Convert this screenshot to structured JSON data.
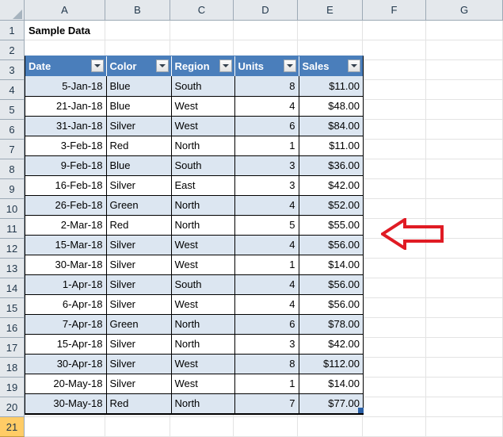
{
  "app": {
    "type": "spreadsheet",
    "title_cell": "Sample Data"
  },
  "colors": {
    "header_blue": "#4A7EBB",
    "band_blue": "#DCE6F1",
    "gutter_gray": "#E4E8EC",
    "active_row_gold": "#FFCC66",
    "annotation_red": "#E01B24",
    "gridline": "#E3E3E3"
  },
  "column_headers": [
    "A",
    "B",
    "C",
    "D",
    "E",
    "F",
    "G"
  ],
  "row_headers": [
    "1",
    "2",
    "3",
    "4",
    "5",
    "6",
    "7",
    "8",
    "9",
    "10",
    "11",
    "12",
    "13",
    "14",
    "15",
    "16",
    "17",
    "18",
    "19",
    "20",
    "21"
  ],
  "active_row_header": "21",
  "table": {
    "range": "A3:E20",
    "columns": [
      {
        "label": "Date",
        "align": "right",
        "filter": true
      },
      {
        "label": "Color",
        "align": "left",
        "filter": true
      },
      {
        "label": "Region",
        "align": "left",
        "filter": true
      },
      {
        "label": "Units",
        "align": "right",
        "filter": true
      },
      {
        "label": "Sales",
        "align": "right",
        "filter": true
      }
    ],
    "rows": [
      {
        "row": "4",
        "date": "5-Jan-18",
        "color": "Blue",
        "region": "South",
        "units": "8",
        "sales": "$11.00"
      },
      {
        "row": "5",
        "date": "21-Jan-18",
        "color": "Blue",
        "region": "West",
        "units": "4",
        "sales": "$48.00"
      },
      {
        "row": "6",
        "date": "31-Jan-18",
        "color": "Silver",
        "region": "West",
        "units": "6",
        "sales": "$84.00"
      },
      {
        "row": "7",
        "date": "3-Feb-18",
        "color": "Red",
        "region": "North",
        "units": "1",
        "sales": "$11.00"
      },
      {
        "row": "8",
        "date": "9-Feb-18",
        "color": "Blue",
        "region": "South",
        "units": "3",
        "sales": "$36.00"
      },
      {
        "row": "9",
        "date": "16-Feb-18",
        "color": "Silver",
        "region": "East",
        "units": "3",
        "sales": "$42.00"
      },
      {
        "row": "10",
        "date": "26-Feb-18",
        "color": "Green",
        "region": "North",
        "units": "4",
        "sales": "$52.00"
      },
      {
        "row": "11",
        "date": "2-Mar-18",
        "color": "Red",
        "region": "North",
        "units": "5",
        "sales": "$55.00"
      },
      {
        "row": "12",
        "date": "15-Mar-18",
        "color": "Silver",
        "region": "West",
        "units": "4",
        "sales": "$56.00"
      },
      {
        "row": "13",
        "date": "30-Mar-18",
        "color": "Silver",
        "region": "West",
        "units": "1",
        "sales": "$14.00"
      },
      {
        "row": "14",
        "date": "1-Apr-18",
        "color": "Silver",
        "region": "South",
        "units": "4",
        "sales": "$56.00"
      },
      {
        "row": "15",
        "date": "6-Apr-18",
        "color": "Silver",
        "region": "West",
        "units": "4",
        "sales": "$56.00"
      },
      {
        "row": "16",
        "date": "7-Apr-18",
        "color": "Green",
        "region": "North",
        "units": "6",
        "sales": "$78.00"
      },
      {
        "row": "17",
        "date": "15-Apr-18",
        "color": "Silver",
        "region": "North",
        "units": "3",
        "sales": "$42.00"
      },
      {
        "row": "18",
        "date": "30-Apr-18",
        "color": "Silver",
        "region": "West",
        "units": "8",
        "sales": "$112.00"
      },
      {
        "row": "19",
        "date": "20-May-18",
        "color": "Silver",
        "region": "West",
        "units": "1",
        "sales": "$14.00"
      },
      {
        "row": "20",
        "date": "30-May-18",
        "color": "Red",
        "region": "North",
        "units": "7",
        "sales": "$77.00"
      }
    ]
  },
  "annotation": {
    "icon": "left-arrow-icon",
    "direction": "left",
    "color": "#E01B24"
  }
}
